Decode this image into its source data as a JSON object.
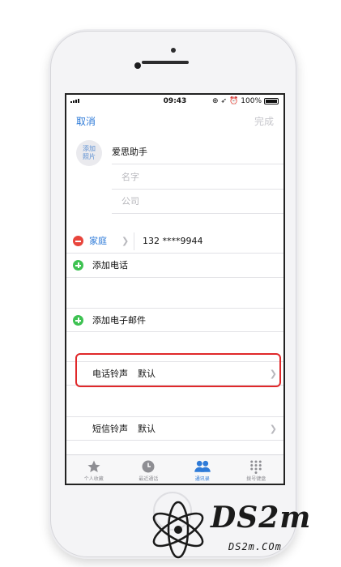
{
  "status_bar": {
    "time": "09:43",
    "battery": "100%"
  },
  "nav": {
    "cancel": "取消",
    "done": "完成"
  },
  "avatar": {
    "line1": "添加",
    "line2": "照片"
  },
  "contact": {
    "last_name": "爱思助手",
    "first_name_placeholder": "名字",
    "company_placeholder": "公司"
  },
  "phone": {
    "label": "家庭",
    "number": "132 ****9944"
  },
  "add_phone": "添加电话",
  "add_email": "添加电子邮件",
  "ringtone": {
    "label": "电话铃声",
    "value": "默认"
  },
  "text_tone": {
    "label": "短信铃声",
    "value": "默认"
  },
  "tabs": [
    {
      "label": "个人收藏",
      "icon": "star-icon"
    },
    {
      "label": "最近通话",
      "icon": "clock-icon"
    },
    {
      "label": "通讯录",
      "icon": "contacts-icon"
    },
    {
      "label": "拨号键盘",
      "icon": "keypad-icon"
    }
  ],
  "watermark": {
    "brand": "DS2m",
    "site": "DS2m.COm"
  },
  "colors": {
    "accent": "#2f7bd8",
    "highlight": "#e0282a",
    "add": "#3ec252",
    "remove": "#e8453c"
  }
}
